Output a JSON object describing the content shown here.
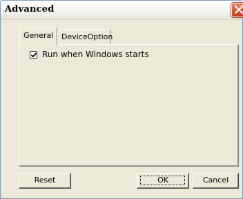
{
  "window": {
    "title": "Advanced"
  },
  "tabs": [
    {
      "label": "General"
    },
    {
      "label": "DeviceOption"
    }
  ],
  "general": {
    "run_on_startup_label": "Run when Windows starts",
    "run_on_startup_checked": true
  },
  "buttons": {
    "reset_label": "Reset",
    "ok_label": "OK",
    "cancel_label": "Cancel"
  },
  "colors": {
    "dialog_background": "#ece9d8",
    "close_button": "#d4553a"
  },
  "icons": {
    "close": "close-icon",
    "checkmark": "checkmark-icon"
  }
}
